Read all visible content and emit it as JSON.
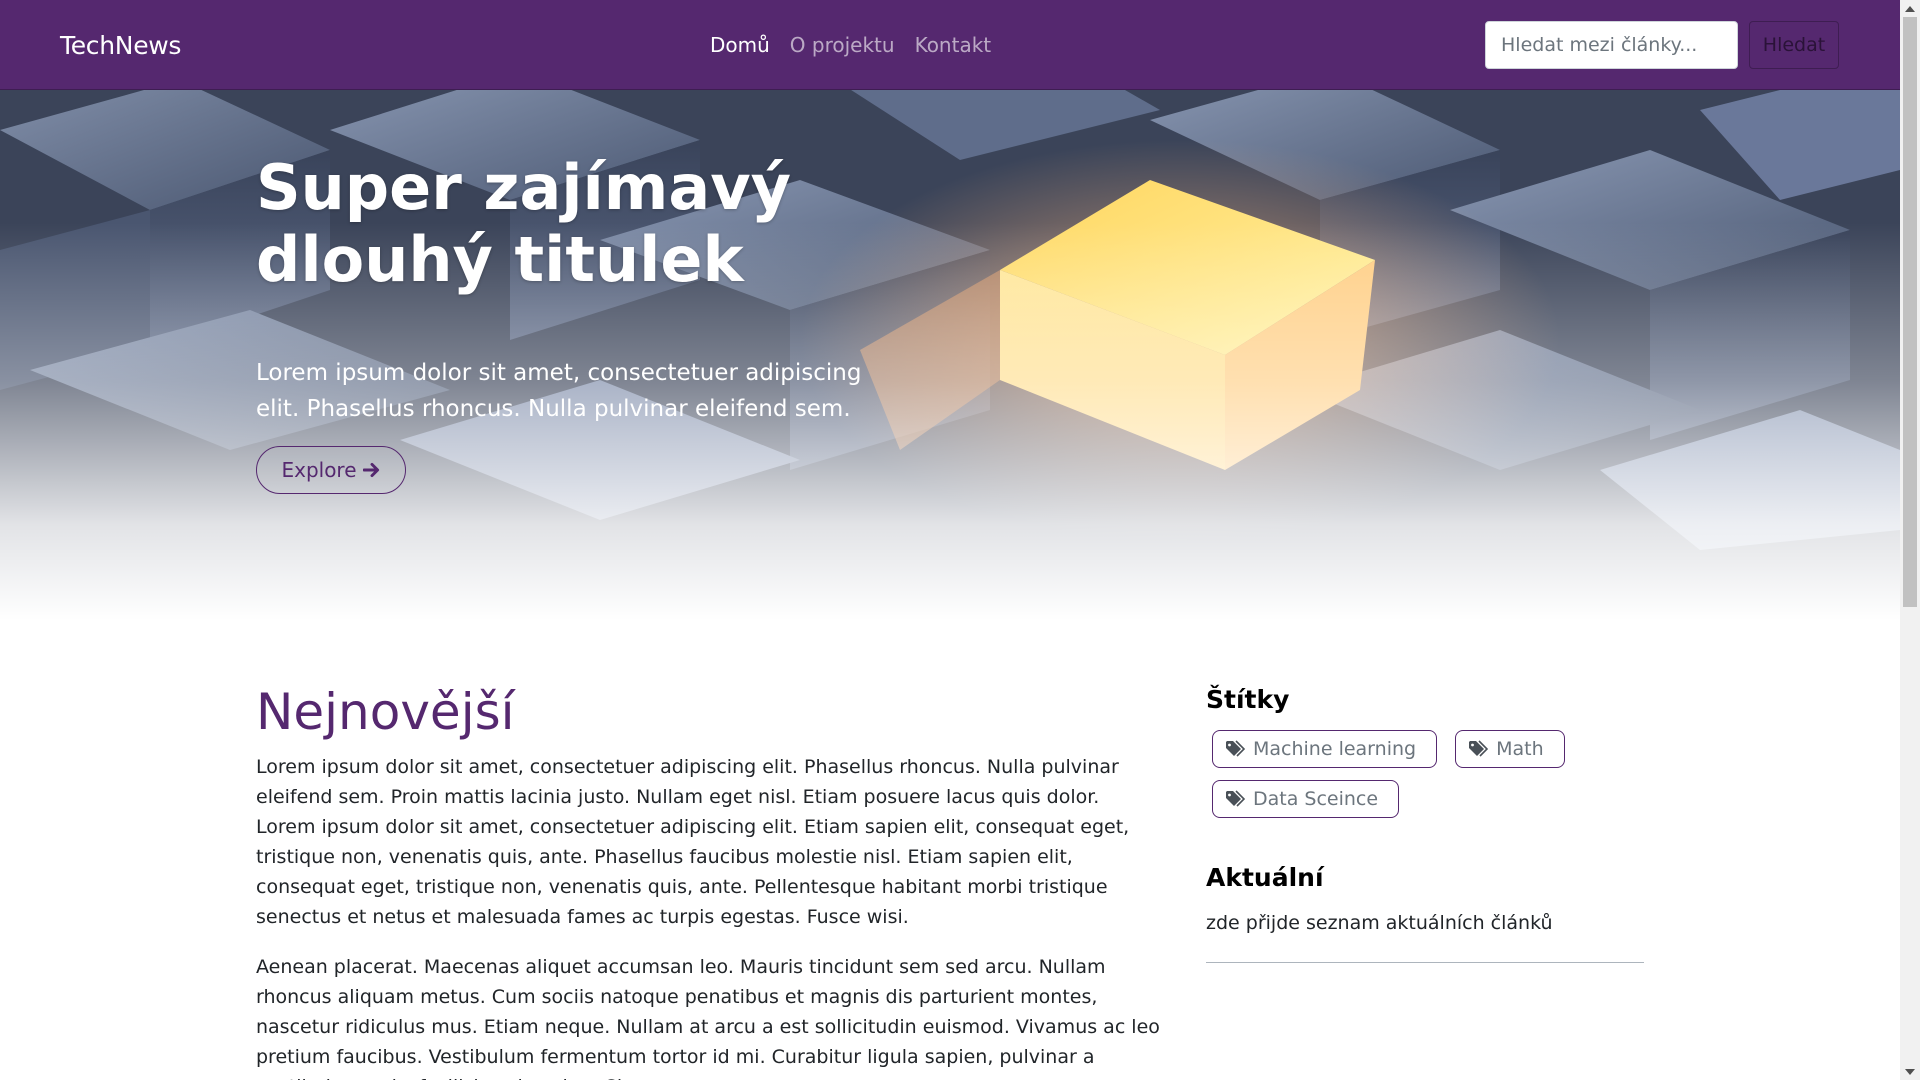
{
  "navbar": {
    "brand": "TechNews",
    "links": [
      {
        "label": "Domů",
        "active": true
      },
      {
        "label": "O projektu",
        "active": false
      },
      {
        "label": "Kontakt",
        "active": false
      }
    ],
    "search_placeholder": "Hledat mezi články...",
    "search_button": "Hledat"
  },
  "hero": {
    "title": "Super zajímavý dlouhý titulek",
    "text": "Lorem ipsum dolor sit amet, consectetuer adipiscing elit. Phasellus rhoncus. Nulla pulvinar eleifend sem.",
    "button_label": "Explore",
    "button_icon": "arrow-right-icon"
  },
  "main": {
    "title": "Nejnovější",
    "paragraphs": [
      "Lorem ipsum dolor sit amet, consectetuer adipiscing elit. Phasellus rhoncus. Nulla pulvinar eleifend sem. Proin mattis lacinia justo. Nullam eget nisl. Etiam posuere lacus quis dolor. Lorem ipsum dolor sit amet, consectetuer adipiscing elit. Etiam sapien elit, consequat eget, tristique non, venenatis quis, ante. Phasellus faucibus molestie nisl. Etiam sapien elit, consequat eget, tristique non, venenatis quis, ante. Pellentesque habitant morbi tristique senectus et netus et malesuada fames ac turpis egestas. Fusce wisi.",
      "Aenean placerat. Maecenas aliquet accumsan leo. Mauris tincidunt sem sed arcu. Nullam rhoncus aliquam metus. Cum sociis natoque penatibus et magnis dis parturient montes, nascetur ridiculus mus. Etiam neque. Nullam at arcu a est sollicitudin euismod. Vivamus ac leo pretium faucibus. Vestibulum fermentum tortor id mi. Curabitur ligula sapien, pulvinar a vestibulum quis, facilisis vel sapien. Class"
    ]
  },
  "sidebar": {
    "tags_heading": "Štítky",
    "tags": [
      "Machine learning",
      "Math",
      "Data Sceince"
    ],
    "tag_icon": "tags-icon",
    "current_heading": "Aktuální",
    "current_text": "zde přijde seznam aktuálních článků"
  },
  "colors": {
    "brand_purple": "#55286f",
    "hero_glow": "#ffe07a"
  }
}
